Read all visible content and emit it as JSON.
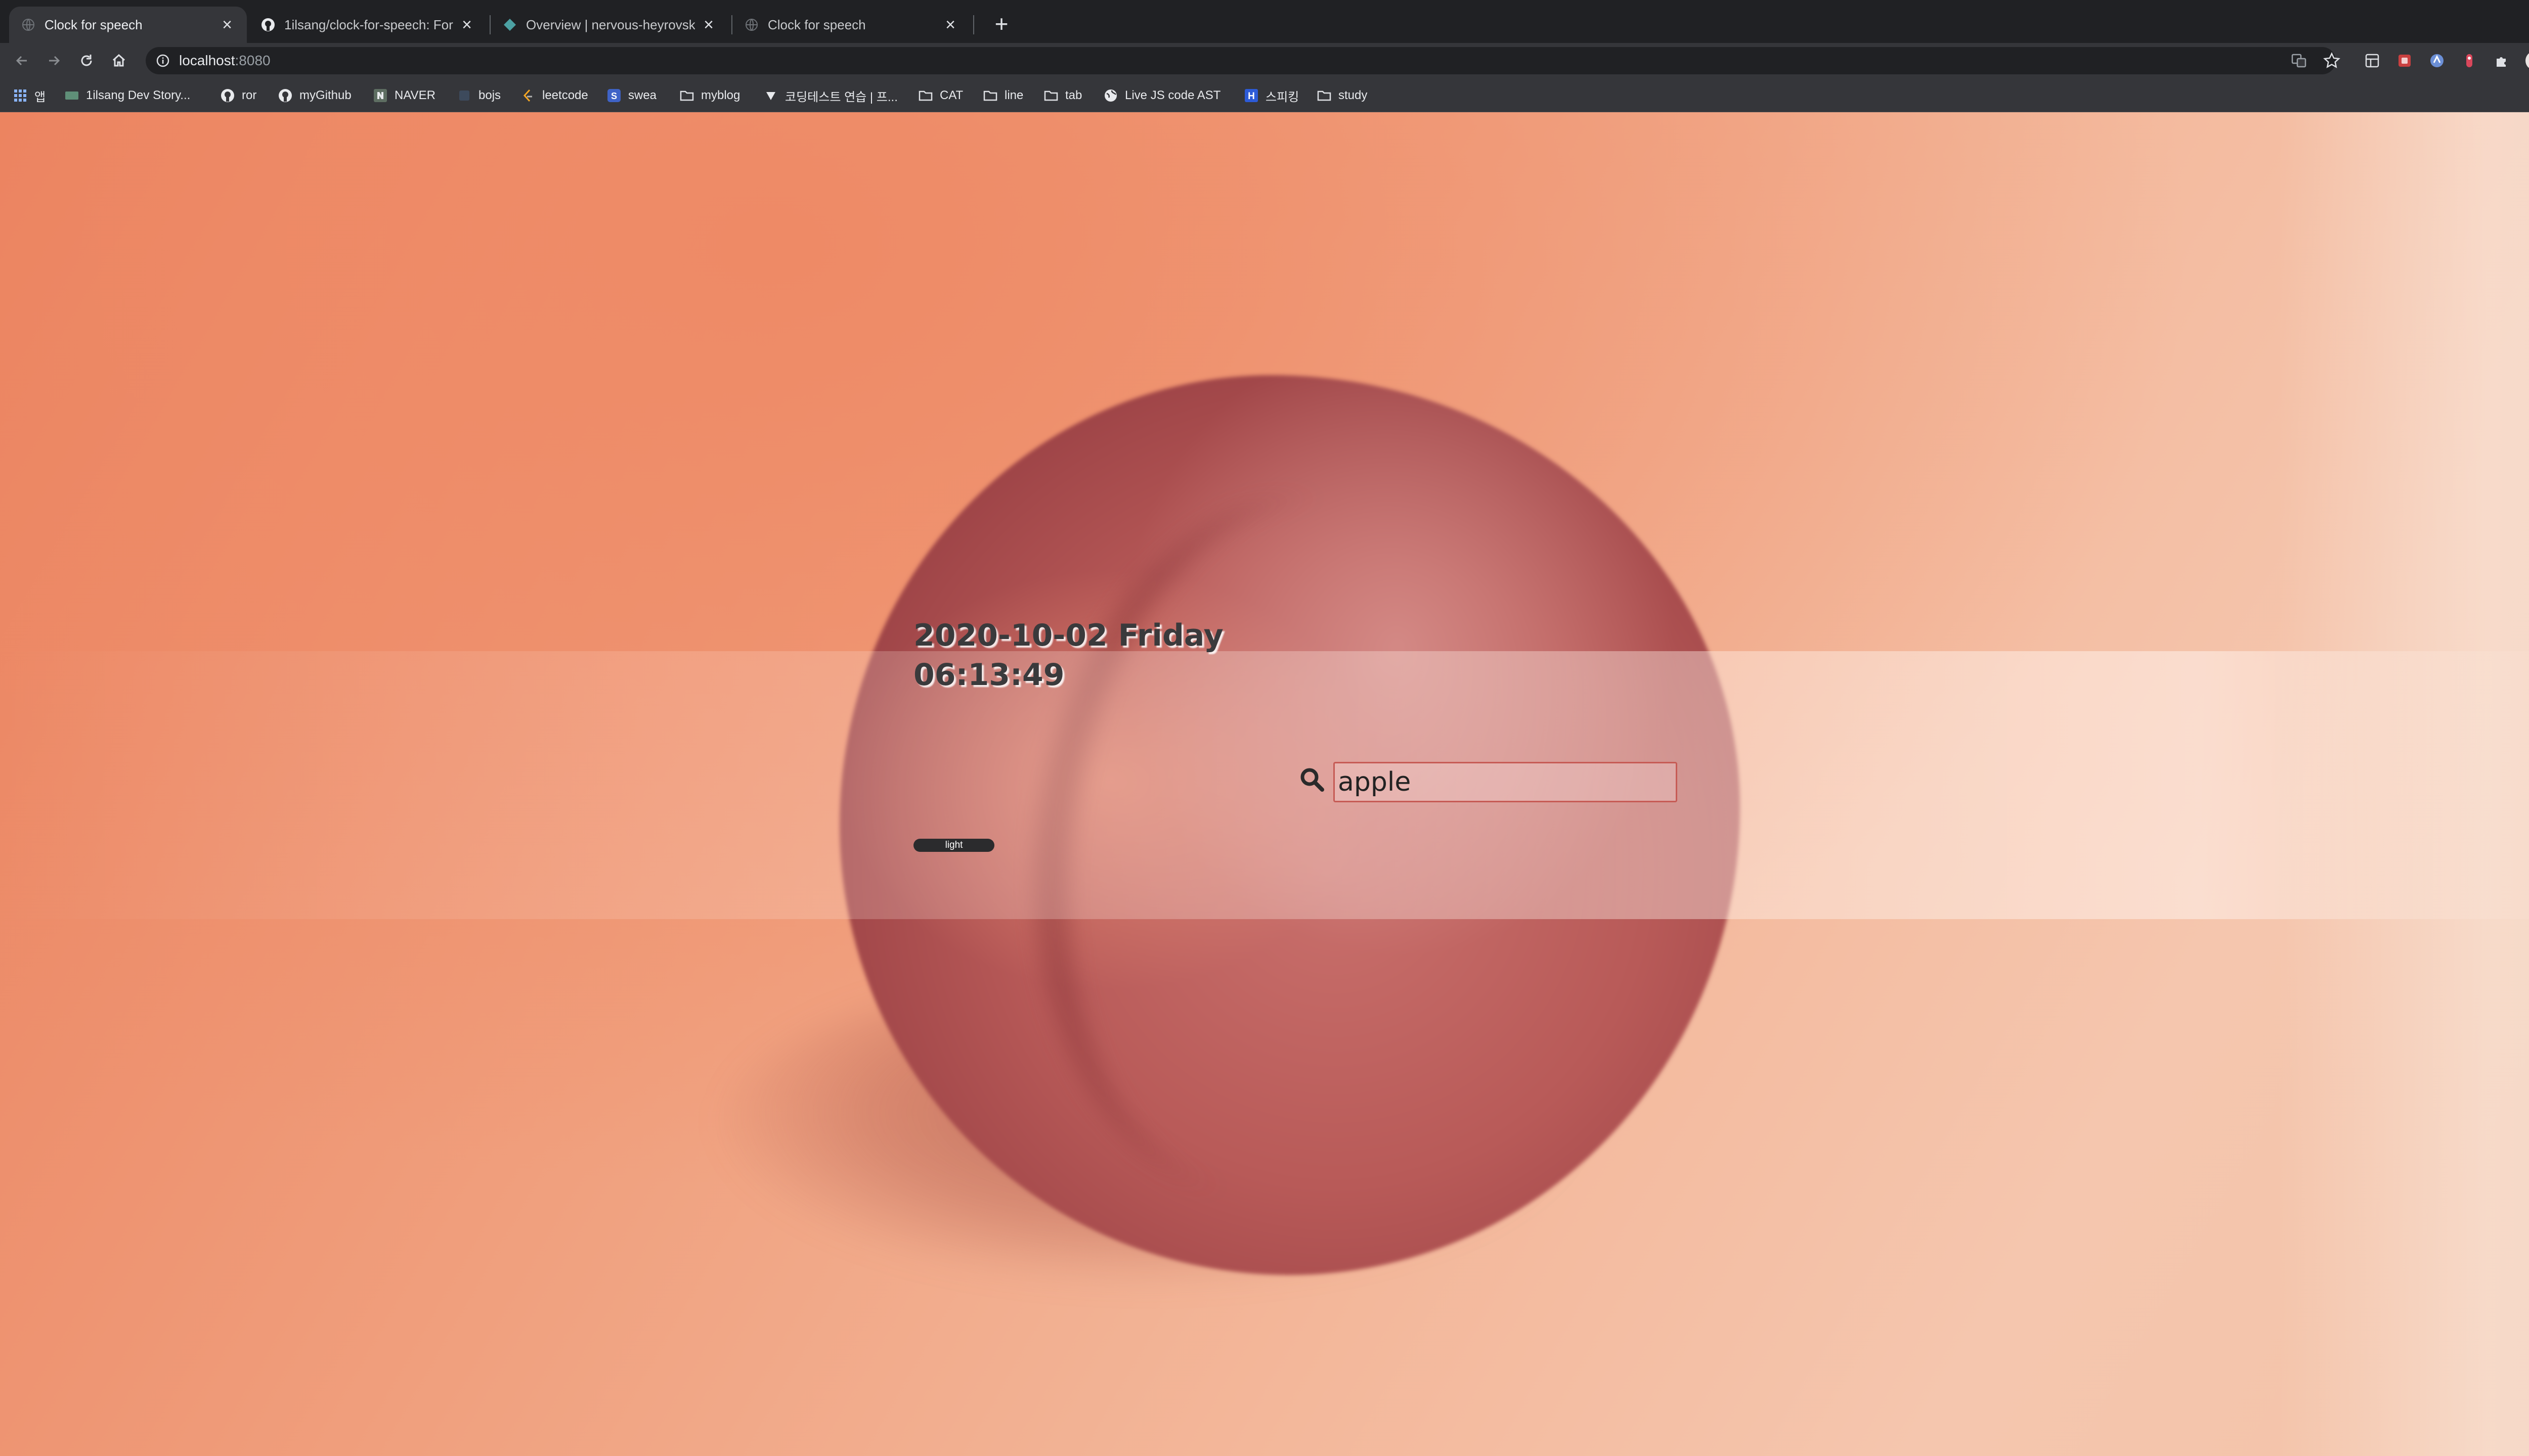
{
  "browser": {
    "tabs": [
      {
        "title": "Clock for speech",
        "active": true
      },
      {
        "title": "1ilsang/clock-for-speech: For J",
        "active": false
      },
      {
        "title": "Overview | nervous-heyrovsky",
        "active": false
      },
      {
        "title": "Clock for speech",
        "active": false
      }
    ],
    "url_host": "localhost",
    "url_port": ":8080",
    "bookmarks": [
      {
        "label": "",
        "icon": "apps-grid-icon"
      },
      {
        "label": "앱",
        "icon": ""
      },
      {
        "label": "1ilsang Dev Story...",
        "icon": "blog-favicon"
      },
      {
        "label": "ror",
        "icon": "github-icon"
      },
      {
        "label": "myGithub",
        "icon": "github-icon"
      },
      {
        "label": "NAVER",
        "icon": "naver-icon"
      },
      {
        "label": "bojs",
        "icon": "bojs-favicon"
      },
      {
        "label": "leetcode",
        "icon": "leetcode-icon"
      },
      {
        "label": "swea",
        "icon": "swea-icon"
      },
      {
        "label": "myblog",
        "icon": "folder-icon"
      },
      {
        "label": "코딩테스트 연습 | 프...",
        "icon": "programmers-icon"
      },
      {
        "label": "CAT",
        "icon": "folder-icon"
      },
      {
        "label": "line",
        "icon": "folder-icon"
      },
      {
        "label": "tab",
        "icon": "folder-icon"
      },
      {
        "label": "Live JS code AST",
        "icon": "globe-icon"
      },
      {
        "label": "스피킹",
        "icon": "h-favicon"
      },
      {
        "label": "study",
        "icon": "folder-icon"
      }
    ]
  },
  "page": {
    "date_line": "2020-10-02 Friday",
    "time_line": "06:13:49",
    "theme_button_label": "light",
    "search_value": "apple"
  },
  "colors": {
    "background_warm": "#ea7f5c",
    "background_light": "#f5c6ae",
    "peach": "#b85a58",
    "input_border": "#c65b55"
  }
}
